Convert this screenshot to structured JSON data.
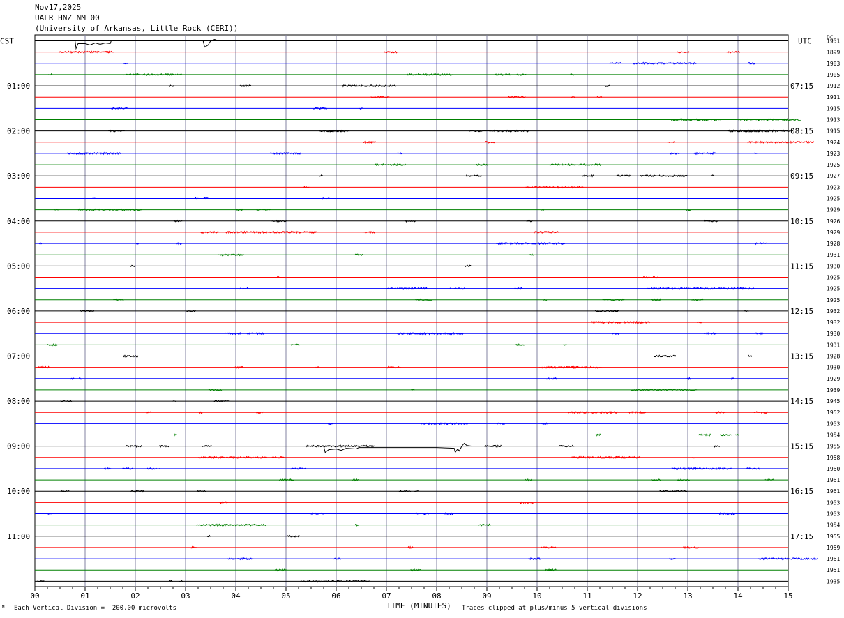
{
  "header": {
    "date": "Nov17,2025",
    "station": "UALR HNZ NM 00",
    "institution": "(University of Arkansas, Little Rock (CERI))"
  },
  "footer": {
    "scale": "Each Vertical Division =  200.00 microvolts",
    "clip_note": "Traces clipped at plus/minus 5 vertical divisions"
  },
  "chart_data": {
    "type": "line",
    "title": "",
    "xlabel": "TIME (MINUTES)",
    "xlim": [
      0,
      15
    ],
    "x_ticks": [
      "00",
      "01",
      "02",
      "03",
      "04",
      "05",
      "06",
      "07",
      "08",
      "09",
      "10",
      "11",
      "12",
      "13",
      "14",
      "15"
    ],
    "left_axis_label": "CST",
    "right_axis_label": "UTC",
    "dc_label": "DC",
    "left_time_labels": [
      "01:00",
      "02:00",
      "03:00",
      "04:00",
      "05:00",
      "06:00",
      "07:00",
      "08:00",
      "09:00",
      "10:00",
      "11:00"
    ],
    "right_time_labels": [
      "07:15",
      "08:15",
      "09:15",
      "10:15",
      "11:15",
      "12:15",
      "13:15",
      "14:15",
      "15:15",
      "16:15",
      "17:15"
    ],
    "trace_colors": [
      "#000000",
      "#ff0000",
      "#0000ff",
      "#008000"
    ],
    "grid": true,
    "dc_values": [
      "1951",
      "1899",
      "1903",
      "1905",
      "1912",
      "1911",
      "1915",
      "1913",
      "1915",
      "1924",
      "1923",
      "1925",
      "1927",
      "1923",
      "1925",
      "1929",
      "1926",
      "1929",
      "1928",
      "1931",
      "1930",
      "1925",
      "1925",
      "1925",
      "1932",
      "1932",
      "1930",
      "1931",
      "1928",
      "1930",
      "1929",
      "1939",
      "1945",
      "1952",
      "1953",
      "1954",
      "1955",
      "1958",
      "1960",
      "1961",
      "1961",
      "1953",
      "1953",
      "1954",
      "1955",
      "1959",
      "1961",
      "1951",
      "1935"
    ]
  }
}
